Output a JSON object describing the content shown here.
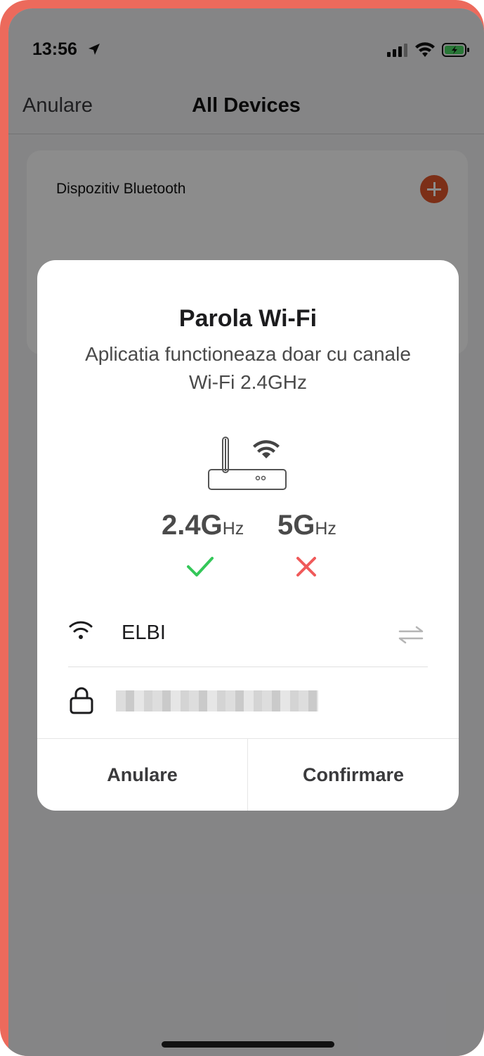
{
  "status_bar": {
    "time": "13:56"
  },
  "nav": {
    "cancel_label": "Anulare",
    "title": "All Devices"
  },
  "background_card": {
    "title": "Dispozitiv Bluetooth"
  },
  "modal": {
    "title": "Parola Wi-Fi",
    "subtitle": "Aplicatia functioneaza doar cu canale Wi-Fi 2.4GHz",
    "freq_24_main": "2.4G",
    "freq_24_unit": "Hz",
    "freq_5_main": "5G",
    "freq_5_unit": "Hz",
    "ssid": "ELBI",
    "cancel_label": "Anulare",
    "confirm_label": "Confirmare"
  },
  "colors": {
    "accent": "#e2562a",
    "check_green": "#34c759",
    "cross_red": "#f05a5a",
    "frame": "#ec6a5c"
  },
  "icons": [
    "location-arrow-icon",
    "signal-icon",
    "wifi-icon",
    "battery-icon",
    "plus-icon",
    "router-icon",
    "check-icon",
    "cross-icon",
    "swap-icon",
    "lock-icon"
  ]
}
